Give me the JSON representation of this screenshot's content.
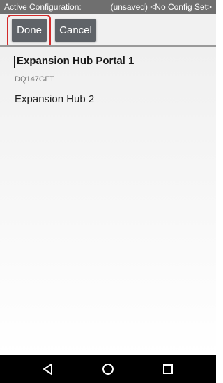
{
  "status_bar": {
    "left_text": "Active Configuration:",
    "right_text": "(unsaved) <No Config Set>"
  },
  "toolbar": {
    "done_label": "Done",
    "cancel_label": "Cancel"
  },
  "form": {
    "name_value": "Expansion Hub Portal 1",
    "serial": "DQ147GFT"
  },
  "devices": [
    {
      "label": "Expansion Hub 2"
    }
  ],
  "nav_bar": {
    "icons": [
      "back-icon",
      "home-icon",
      "recents-icon"
    ]
  },
  "colors": {
    "focus_ring": "#d22b2b",
    "button_bg": "#5f6368",
    "field_underline": "#3b7fb8"
  }
}
